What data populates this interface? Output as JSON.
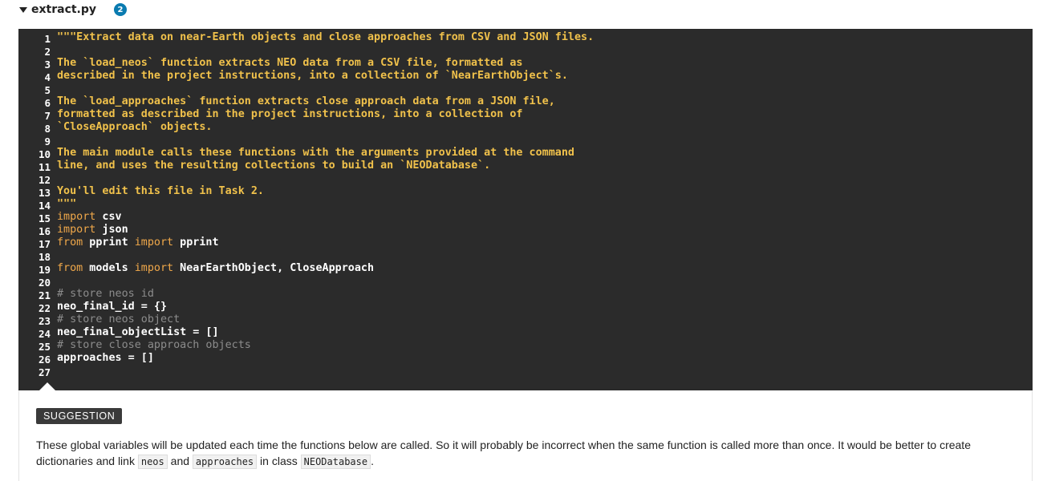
{
  "file": {
    "name": "extract.py",
    "badge_count": "2"
  },
  "code": {
    "gutter": [
      "1",
      "2",
      "3",
      "4",
      "5",
      "6",
      "7",
      "8",
      "9",
      "10",
      "11",
      "12",
      "13",
      "14",
      "15",
      "16",
      "17",
      "18",
      "19",
      "20",
      "21",
      "22",
      "23",
      "24",
      "25",
      "26",
      "27"
    ],
    "lines": [
      [
        {
          "t": "doc",
          "s": "\"\"\"Extract data on near-Earth objects and close approaches from CSV and JSON files."
        }
      ],
      [
        {
          "t": "doc",
          "s": ""
        }
      ],
      [
        {
          "t": "doc",
          "s": "The `load_neos` function extracts NEO data from a CSV file, formatted as"
        }
      ],
      [
        {
          "t": "doc",
          "s": "described in the project instructions, into a collection of `NearEarthObject`s."
        }
      ],
      [
        {
          "t": "doc",
          "s": ""
        }
      ],
      [
        {
          "t": "doc",
          "s": "The `load_approaches` function extracts close approach data from a JSON file,"
        }
      ],
      [
        {
          "t": "doc",
          "s": "formatted as described in the project instructions, into a collection of"
        }
      ],
      [
        {
          "t": "doc",
          "s": "`CloseApproach` objects."
        }
      ],
      [
        {
          "t": "doc",
          "s": ""
        }
      ],
      [
        {
          "t": "doc",
          "s": "The main module calls these functions with the arguments provided at the command"
        }
      ],
      [
        {
          "t": "doc",
          "s": "line, and uses the resulting collections to build an `NEODatabase`."
        }
      ],
      [
        {
          "t": "doc",
          "s": ""
        }
      ],
      [
        {
          "t": "doc",
          "s": "You'll edit this file in Task 2."
        }
      ],
      [
        {
          "t": "doc",
          "s": "\"\"\""
        }
      ],
      [
        {
          "t": "kw",
          "s": "import"
        },
        {
          "t": "plain",
          "s": " csv"
        }
      ],
      [
        {
          "t": "kw",
          "s": "import"
        },
        {
          "t": "plain",
          "s": " json"
        }
      ],
      [
        {
          "t": "kw",
          "s": "from"
        },
        {
          "t": "plain",
          "s": " pprint "
        },
        {
          "t": "kw",
          "s": "import"
        },
        {
          "t": "plain",
          "s": " pprint"
        }
      ],
      [
        {
          "t": "plain",
          "s": ""
        }
      ],
      [
        {
          "t": "kw",
          "s": "from"
        },
        {
          "t": "plain",
          "s": " models "
        },
        {
          "t": "kw",
          "s": "import"
        },
        {
          "t": "plain",
          "s": " NearEarthObject, CloseApproach"
        }
      ],
      [
        {
          "t": "plain",
          "s": ""
        }
      ],
      [
        {
          "t": "cmt",
          "s": "# store neos id"
        }
      ],
      [
        {
          "t": "plain",
          "s": "neo_final_id = {}"
        }
      ],
      [
        {
          "t": "cmt",
          "s": "# store neos object"
        }
      ],
      [
        {
          "t": "plain",
          "s": "neo_final_objectList = []"
        }
      ],
      [
        {
          "t": "cmt",
          "s": "# store close approach objects"
        }
      ],
      [
        {
          "t": "plain",
          "s": "approaches = []"
        }
      ],
      [
        {
          "t": "plain",
          "s": ""
        }
      ]
    ]
  },
  "suggestion": {
    "tag": "SUGGESTION",
    "text_part1": "These global variables will be updated each time the functions below are called. So it will probably be incorrect when the same function is called more than once. It would be better to create dictionaries and link ",
    "code1": "neos",
    "text_part2": " and ",
    "code2": "approaches",
    "text_part3": " in class ",
    "code3": "NEODatabase",
    "text_part4": "."
  }
}
